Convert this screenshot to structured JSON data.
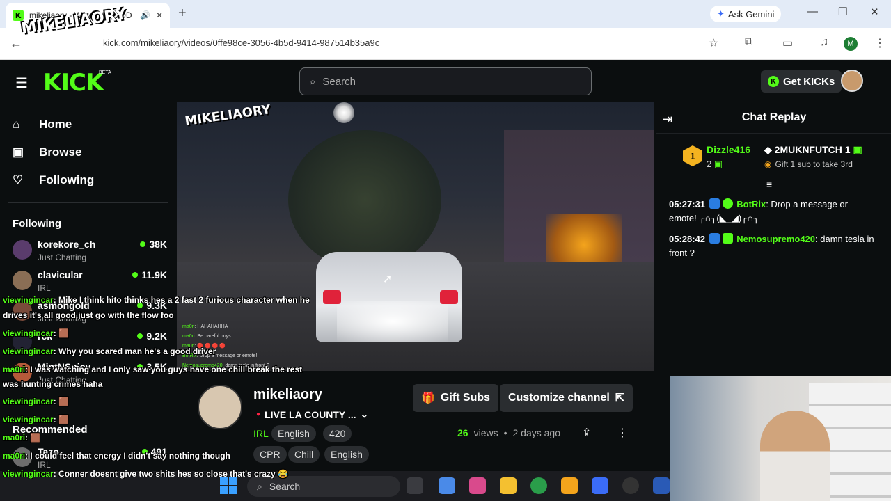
{
  "browser": {
    "tab_title": "mikeliaory - Watch the VOD",
    "url": "kick.com/mikeliaory/videos/0ffe98ce-3056-4b5d-9414-987514b35a9c",
    "gemini_label": "Ask Gemini",
    "profile_initial": "M"
  },
  "header": {
    "logo": "KICK",
    "beta": "BETA",
    "search_placeholder": "Search",
    "get_kicks": "Get KICKs"
  },
  "overlay_logo": "MIKELIAORY",
  "sidebar": {
    "nav": [
      {
        "label": "Home"
      },
      {
        "label": "Browse"
      },
      {
        "label": "Following"
      }
    ],
    "following_title": "Following",
    "following": [
      {
        "name": "korekore_ch",
        "category": "Just Chatting",
        "viewers": "38K"
      },
      {
        "name": "clavicular",
        "category": "IRL",
        "viewers": "11.9K"
      },
      {
        "name": "asmongold",
        "category": "Just Chatting",
        "viewers": "9.3K"
      },
      {
        "name": "rck",
        "category": "",
        "viewers": "9.2K"
      },
      {
        "name": "MintNSpicy",
        "category": "Just Chatting",
        "viewers": "3.5K"
      }
    ],
    "recommended_title": "Recommended",
    "recommended": [
      {
        "name": "Tazo",
        "category": "IRL",
        "viewers": "491"
      }
    ]
  },
  "video": {
    "watermark": "MIKELIAORY",
    "overlay_chat": [
      {
        "user": "ma0ri",
        "text": ": HAHAHAHHA"
      },
      {
        "user": "ma0ri",
        "text": ": Be careful boys"
      },
      {
        "user": "ma0ri",
        "text": ": 🔴 🔴 🔴 🔴"
      },
      {
        "user": "BotRix",
        "text": ": Drop a message or emote!"
      },
      {
        "user": "Nemosupremo420",
        "text": ": damn tesla in front ?"
      }
    ]
  },
  "stream_chat_overlay": [
    {
      "user": "viewingincar",
      "text": ": Mike I think hito thinks hes a 2 fast 2 furious character when he"
    },
    {
      "user": "",
      "text": "drives it's all good just go with the flow foo"
    },
    {
      "user": "viewingincar",
      "text": ": 🟫"
    },
    {
      "user": "viewingincar",
      "text": ": Why you scared man he's a good driver"
    },
    {
      "user": "ma0ri",
      "text": ": I was watching and I only saw you guys have one chill break the rest"
    },
    {
      "user": "",
      "text": "was hunting crimes haha"
    },
    {
      "user": "viewingincar",
      "text": ": 🟫"
    },
    {
      "user": "viewingincar",
      "text": ": 🟫"
    },
    {
      "user": "ma0ri",
      "text": ": 🟫"
    },
    {
      "user": "ma0ri",
      "text": ": I could feel that energy I didn't say nothing though"
    },
    {
      "user": "viewingincar",
      "text": ": Conner doesnt give two shits hes so close that's crazy 😂"
    }
  ],
  "channel": {
    "name": "mikeliaory",
    "title": "LIVE LA COUNTY ...",
    "category": "IRL",
    "tags": [
      "English",
      "420",
      "CPR",
      "Chill",
      "English"
    ],
    "gift_subs": "Gift Subs",
    "customize": "Customize channel",
    "views": "26",
    "views_label": "views",
    "age": "2 days ago"
  },
  "chat": {
    "title": "Chat Replay",
    "leader_rank": "1",
    "leader_name": "Dizzle416",
    "leader_count": "2",
    "second_name": "2MUKNFUTCH",
    "second_count": "1",
    "gift_hint": "Gift 1 sub to take 3rd",
    "messages": [
      {
        "time": "05:27:31",
        "user": "BotRix",
        "text": ": Drop a message or emote! ╭∩╮(◣_◢)╭∩╮"
      },
      {
        "time": "05:28:42",
        "user": "Nemosupremo420",
        "text": ": damn tesla in front ?"
      }
    ]
  },
  "taskbar": {
    "search": "Search"
  },
  "colors": {
    "accent": "#53fc18",
    "bg": "#0b0e0f"
  }
}
